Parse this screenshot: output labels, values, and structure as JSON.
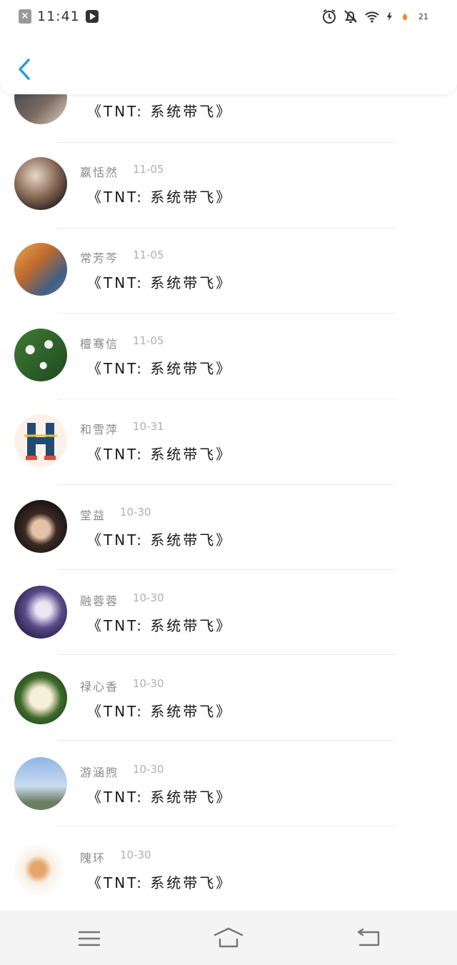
{
  "status_bar": {
    "time": "11:41",
    "battery_level": "21",
    "icons": [
      "close-icon",
      "play-icon",
      "alarm-icon",
      "mute-bell-icon",
      "wifi-icon",
      "charging-icon",
      "battery-icon"
    ]
  },
  "header": {
    "back_icon": "chevron-left-icon",
    "accent_color": "#2a98e6"
  },
  "list": {
    "partial_top": {
      "message": "《TNT: 系统带飞》"
    },
    "items": [
      {
        "name": "嬴恬然",
        "date": "11-05",
        "message": "《TNT: 系统带飞》"
      },
      {
        "name": "常芳芩",
        "date": "11-05",
        "message": "《TNT: 系统带飞》"
      },
      {
        "name": "檀骞信",
        "date": "11-05",
        "message": "《TNT: 系统带飞》"
      },
      {
        "name": "和雪萍",
        "date": "10-31",
        "message": "《TNT: 系统带飞》"
      },
      {
        "name": "堂益",
        "date": "10-30",
        "message": "《TNT: 系统带飞》"
      },
      {
        "name": "融蓉蓉",
        "date": "10-30",
        "message": "《TNT: 系统带飞》"
      },
      {
        "name": "禄心香",
        "date": "10-30",
        "message": "《TNT: 系统带飞》"
      },
      {
        "name": "游涵煦",
        "date": "10-30",
        "message": "《TNT: 系统带飞》"
      },
      {
        "name": "隗环",
        "date": "10-30",
        "message": "《TNT: 系统带飞》"
      }
    ]
  },
  "bottom_nav": {
    "icons": [
      "menu-icon",
      "home-icon",
      "back-icon"
    ]
  }
}
